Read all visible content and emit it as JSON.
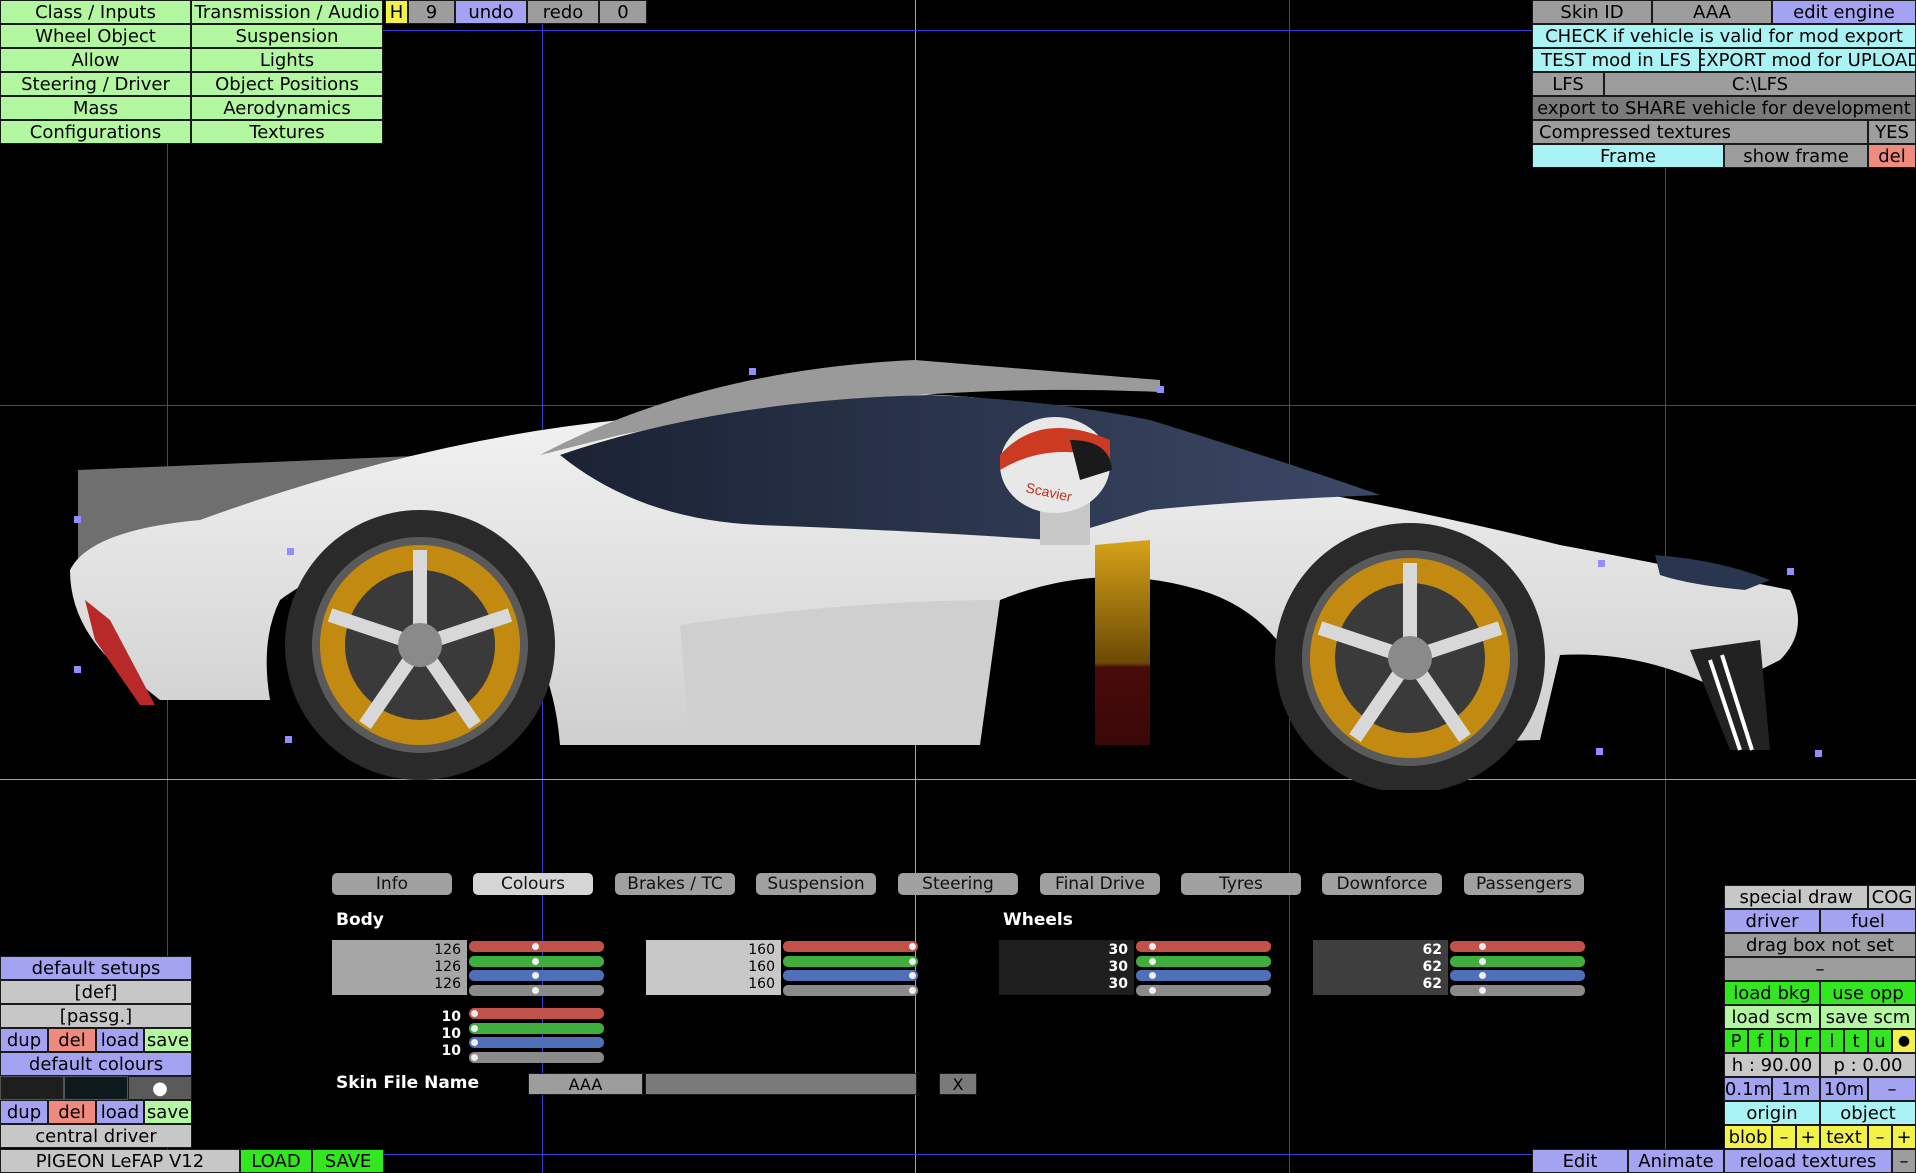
{
  "top_left_menu": [
    [
      "Class / Inputs",
      "Transmission / Audio"
    ],
    [
      "Wheel Object",
      "Suspension"
    ],
    [
      "Allow",
      "Lights"
    ],
    [
      "Steering / Driver",
      "Object Positions"
    ],
    [
      "Mass",
      "Aerodynamics"
    ],
    [
      "Configurations",
      "Textures"
    ]
  ],
  "top_bar": {
    "h": "H",
    "num": "9",
    "undo": "undo",
    "redo": "redo",
    "zero": "0"
  },
  "top_right": {
    "skin_id": "Skin ID",
    "skin_value": "AAA",
    "edit_engine": "edit engine",
    "check_valid": "CHECK if vehicle is valid for mod export",
    "test_mod": "TEST mod in LFS",
    "export_mod": "EXPORT mod for UPLOAD",
    "lfs": "LFS",
    "path": "C:\\LFS",
    "export_share": "export to SHARE vehicle for development",
    "compressed": "Compressed textures",
    "yes": "YES",
    "frame": "Frame",
    "show_frame": "show frame",
    "del": "del"
  },
  "tabs": [
    "Info",
    "Colours",
    "Brakes / TC",
    "Suspension",
    "Steering",
    "Final Drive",
    "Tyres",
    "Downforce",
    "Passengers"
  ],
  "colours": {
    "body_label": "Body",
    "wheels_label": "Wheels",
    "body1": {
      "vals": [
        "126",
        "126",
        "126"
      ],
      "swatch": "#a6a6a6",
      "fracs": [
        0.49,
        0.49,
        0.49,
        0.49
      ]
    },
    "body2": {
      "vals": [
        "160",
        "160",
        "160"
      ],
      "swatch": "#c8c8c8",
      "fracs": [
        0.98,
        0.98,
        0.98,
        0.98
      ]
    },
    "body3": {
      "vals": [
        "10",
        "10",
        "10"
      ],
      "fracs": [
        0.04,
        0.04,
        0.04,
        0.04
      ]
    },
    "wheel1": {
      "vals": [
        "30",
        "30",
        "30"
      ],
      "swatch": "#1e1e1e",
      "fracs": [
        0.12,
        0.12,
        0.12,
        0.12
      ]
    },
    "wheel2": {
      "vals": [
        "62",
        "62",
        "62"
      ],
      "swatch": "#3e3e3e",
      "fracs": [
        0.24,
        0.24,
        0.24,
        0.24
      ]
    },
    "skin_file_label": "Skin File Name",
    "skin_file_value": "AAA",
    "x": "X"
  },
  "bottom_left": {
    "default_setups": "default setups",
    "def": "[def]",
    "passg": "[passg.]",
    "dup": "dup",
    "del": "del",
    "load": "load",
    "save": "save",
    "default_colours": "default colours",
    "dot": "●",
    "central_driver": "central driver",
    "car_name": "PIGEON LeFAP V12",
    "LOAD": "LOAD",
    "SAVE": "SAVE"
  },
  "bottom_right": {
    "special_draw": "special draw",
    "cog": "COG",
    "driver": "driver",
    "fuel": "fuel",
    "drag_box": "drag box not set",
    "dash": "–",
    "load_bkg": "load bkg",
    "use_opp": "use opp",
    "load_scm": "load scm",
    "save_scm": "save scm",
    "views": [
      "P",
      "f",
      "b",
      "r",
      "l",
      "t",
      "u",
      "●"
    ],
    "h": "h : 90.00",
    "p": "p : 0.00",
    "steps": [
      "0.1m",
      "1m",
      "10m",
      "–"
    ],
    "origin": "origin",
    "object": "object",
    "blob": "blob",
    "minus": "–",
    "plus": "+",
    "text": "text",
    "edit": "Edit",
    "animate": "Animate",
    "reload_textures": "reload textures"
  },
  "car_decal": "Scavier",
  "colors": {
    "grid_blue": "#3a3ad6",
    "grid_cyan": "#4fc6d6"
  }
}
